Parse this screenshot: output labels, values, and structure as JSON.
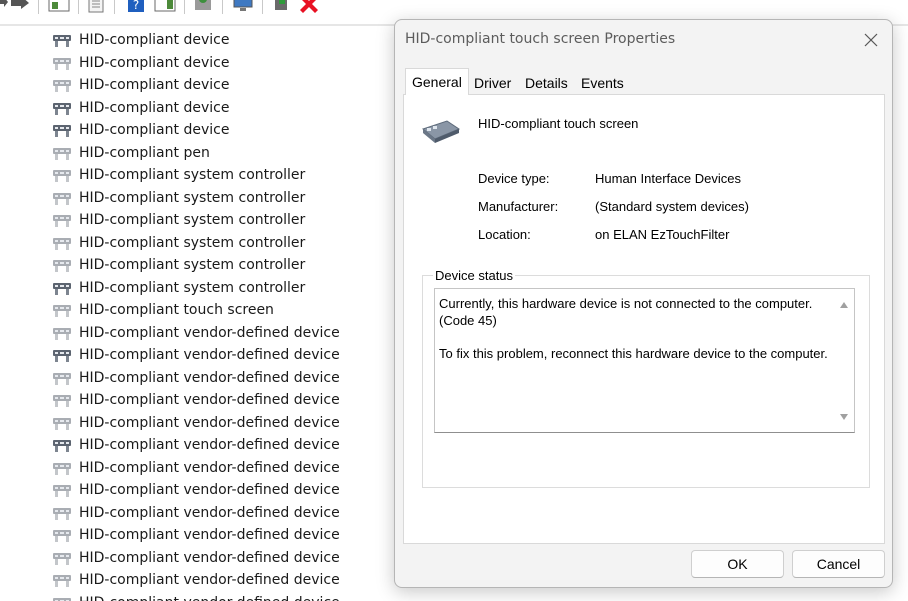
{
  "toolbar": {
    "icons": [
      "back-arrow-icon",
      "forward-arrow-icon",
      "show-hide-console-tree-icon",
      "properties-icon",
      "help-icon",
      "action-pane-icon",
      "scan-hardware-icon",
      "monitor-icon",
      "update-driver-icon",
      "uninstall-device-icon"
    ]
  },
  "device_tree": {
    "items": [
      {
        "label": "HID-compliant device",
        "icon": "hid-device-icon",
        "dimmed": false
      },
      {
        "label": "HID-compliant device",
        "icon": "hid-device-icon",
        "dimmed": true
      },
      {
        "label": "HID-compliant device",
        "icon": "hid-device-icon",
        "dimmed": true
      },
      {
        "label": "HID-compliant device",
        "icon": "hid-device-icon",
        "dimmed": false
      },
      {
        "label": "HID-compliant device",
        "icon": "hid-device-icon",
        "dimmed": false
      },
      {
        "label": "HID-compliant pen",
        "icon": "hid-device-icon",
        "dimmed": true
      },
      {
        "label": "HID-compliant system controller",
        "icon": "hid-device-icon",
        "dimmed": true
      },
      {
        "label": "HID-compliant system controller",
        "icon": "hid-device-icon",
        "dimmed": true
      },
      {
        "label": "HID-compliant system controller",
        "icon": "hid-device-icon",
        "dimmed": true
      },
      {
        "label": "HID-compliant system controller",
        "icon": "hid-device-icon",
        "dimmed": true
      },
      {
        "label": "HID-compliant system controller",
        "icon": "hid-device-icon",
        "dimmed": true
      },
      {
        "label": "HID-compliant system controller",
        "icon": "hid-device-icon",
        "dimmed": false
      },
      {
        "label": "HID-compliant touch screen",
        "icon": "hid-device-icon",
        "dimmed": true
      },
      {
        "label": "HID-compliant vendor-defined device",
        "icon": "hid-device-icon",
        "dimmed": true
      },
      {
        "label": "HID-compliant vendor-defined device",
        "icon": "hid-device-icon",
        "dimmed": false
      },
      {
        "label": "HID-compliant vendor-defined device",
        "icon": "hid-device-icon",
        "dimmed": true
      },
      {
        "label": "HID-compliant vendor-defined device",
        "icon": "hid-device-icon",
        "dimmed": true
      },
      {
        "label": "HID-compliant vendor-defined device",
        "icon": "hid-device-icon",
        "dimmed": true
      },
      {
        "label": "HID-compliant vendor-defined device",
        "icon": "hid-device-icon",
        "dimmed": false
      },
      {
        "label": "HID-compliant vendor-defined device",
        "icon": "hid-device-icon",
        "dimmed": true
      },
      {
        "label": "HID-compliant vendor-defined device",
        "icon": "hid-device-icon",
        "dimmed": true
      },
      {
        "label": "HID-compliant vendor-defined device",
        "icon": "hid-device-icon",
        "dimmed": true
      },
      {
        "label": "HID-compliant vendor-defined device",
        "icon": "hid-device-icon",
        "dimmed": true
      },
      {
        "label": "HID-compliant vendor-defined device",
        "icon": "hid-device-icon",
        "dimmed": true
      },
      {
        "label": "HID-compliant vendor-defined device",
        "icon": "hid-device-icon",
        "dimmed": true
      },
      {
        "label": "HID-compliant vendor-defined device",
        "icon": "hid-device-icon",
        "dimmed": true
      }
    ]
  },
  "dialog": {
    "title": "HID-compliant touch screen Properties",
    "tabs": [
      "General",
      "Driver",
      "Details",
      "Events"
    ],
    "active_tab": "General",
    "device_name": "HID-compliant touch screen",
    "properties": [
      {
        "label": "Device type:",
        "value": "Human Interface Devices"
      },
      {
        "label": "Manufacturer:",
        "value": "(Standard system devices)"
      },
      {
        "label": "Location:",
        "value": "on ELAN EzTouchFilter"
      }
    ],
    "status_group_label": "Device status",
    "status_paragraphs": [
      "Currently, this hardware device is not connected to the computer. (Code 45)",
      "To fix this problem, reconnect this hardware device to the computer."
    ],
    "ok_label": "OK",
    "cancel_label": "Cancel"
  },
  "colors": {
    "uninstall_red": "#e81123",
    "help_blue": "#1f5fbf",
    "update_green": "#2e9b3a"
  }
}
